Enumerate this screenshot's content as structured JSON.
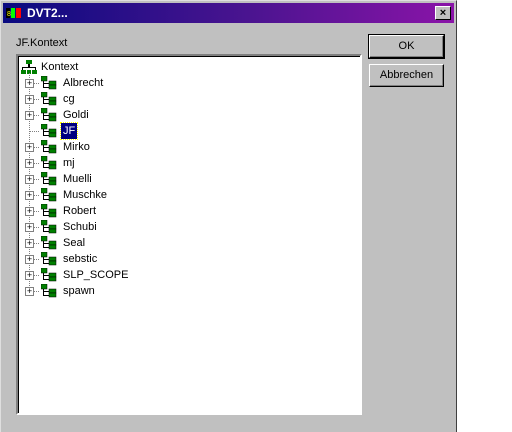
{
  "window": {
    "title": "DVT2..."
  },
  "titlebar": {
    "close_label": "×"
  },
  "context_label": "JF.Kontext",
  "tree": {
    "root_label": "Kontext",
    "items": [
      {
        "label": "Albrecht",
        "expand": "+"
      },
      {
        "label": "cg",
        "expand": "+"
      },
      {
        "label": "Goldi",
        "expand": "+"
      },
      {
        "label": "JF",
        "expand": "",
        "selected": true
      },
      {
        "label": "Mirko",
        "expand": "+"
      },
      {
        "label": "mj",
        "expand": "+"
      },
      {
        "label": "Muelli",
        "expand": "+"
      },
      {
        "label": "Muschke",
        "expand": "+"
      },
      {
        "label": "Robert",
        "expand": "+"
      },
      {
        "label": "Schubi",
        "expand": "+"
      },
      {
        "label": "Seal",
        "expand": "+"
      },
      {
        "label": "sebstic",
        "expand": "+"
      },
      {
        "label": "SLP_SCOPE",
        "expand": "+"
      },
      {
        "label": "spawn",
        "expand": "+"
      }
    ]
  },
  "buttons": {
    "ok": "OK",
    "cancel": "Abbrechen"
  },
  "icons": {
    "app": "app-icon",
    "close": "close-icon",
    "root": "network-tree-icon",
    "item": "network-node-icon"
  },
  "colors": {
    "title_start": "#0a0a80",
    "title_end": "#8a14a8",
    "selection": "#000080"
  }
}
